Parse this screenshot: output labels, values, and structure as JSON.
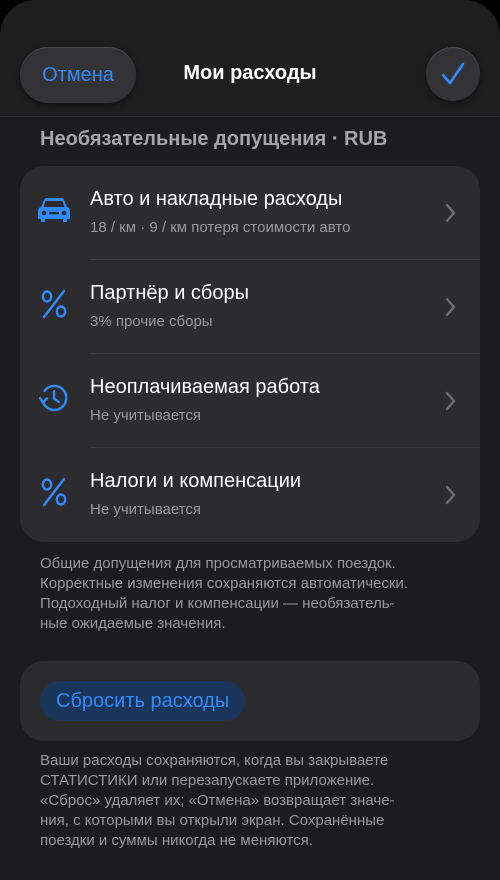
{
  "colors": {
    "accent": "#2f8bff",
    "background": "#1c1c1e",
    "card": "#2c2c2e",
    "secondary_text": "#98989e"
  },
  "nav": {
    "cancel_label": "Отмена",
    "title": "Мои расходы",
    "done_icon": "checkmark-icon"
  },
  "section": {
    "header": "Необязательные допущения · RUB"
  },
  "rows": [
    {
      "icon": "car-icon",
      "title": "Авто и накладные расходы",
      "subtitle": "18 / км · 9 / км потеря стоимости авто"
    },
    {
      "icon": "percent-icon",
      "title": "Партнёр и сборы",
      "subtitle": "3% прочие сборы"
    },
    {
      "icon": "clock-history-icon",
      "title": "Неоплачиваемая работа",
      "subtitle": "Не учитывается"
    },
    {
      "icon": "percent-icon",
      "title": "Налоги и компенсации",
      "subtitle": "Не учитывается"
    }
  ],
  "footnote1": {
    "lines": [
      "Общие допущения для просматриваемых поездок.",
      "Корректные изменения сохраняются автоматически.",
      "Подоходный налог и компенсации — необязатель-",
      "ные ожидаемые значения."
    ]
  },
  "reset": {
    "label": "Сбросить расходы"
  },
  "footnote2": {
    "lines": [
      "Ваши расходы сохраняются, когда вы закрываете",
      "СТАТИСТИКИ или перезапускаете приложение.",
      "«Сброс» удаляет их; «Отмена» возвращает значе-",
      "ния, с которыми вы открыли экран. Сохранённые",
      "поездки и суммы никогда не меняются."
    ]
  }
}
